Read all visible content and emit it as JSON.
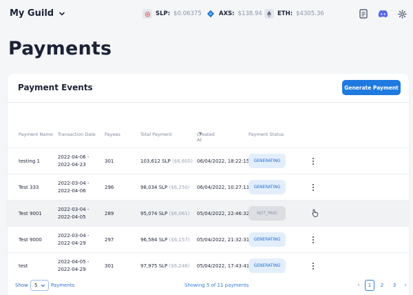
{
  "header": {
    "guild_name": "My Guild",
    "tickers": [
      {
        "symbol": "SLP:",
        "price": "$0.06375",
        "icon": "slp-token-icon"
      },
      {
        "symbol": "AXS:",
        "price": "$138.94",
        "icon": "axs-token-icon"
      },
      {
        "symbol": "ETH:",
        "price": "$4305.36",
        "icon": "eth-token-icon"
      }
    ],
    "icons": [
      "document-icon",
      "discord-icon",
      "gear-icon"
    ]
  },
  "page": {
    "title": "Payments"
  },
  "card": {
    "title": "Payment Events",
    "generate_button": "Generate Payment"
  },
  "table": {
    "columns": [
      "Payment Name",
      "Transaction Date",
      "Payees",
      "Total Payment",
      "Created At",
      "Payment Status"
    ],
    "sort_column": "Created At",
    "rows": [
      {
        "name": "testing 1",
        "date_from": "2022-04-06 -",
        "date_to": "2022-04-23",
        "payees": "301",
        "slp": "103,612 SLP",
        "usd": "($6,605)",
        "created": "06/04/2022, 18:22:15",
        "status": "GENERATING"
      },
      {
        "name": "Test 333",
        "date_from": "2022-03-04 -",
        "date_to": "2022-04-06",
        "payees": "296",
        "slp": "98,034 SLP",
        "usd": "($6,250)",
        "created": "06/04/2022, 10:27:11",
        "status": "GENERATING"
      },
      {
        "name": "Test 9001",
        "date_from": "2022-03-04 -",
        "date_to": "2022-04-05",
        "payees": "289",
        "slp": "95,074 SLP",
        "usd": "($6,061)",
        "created": "05/04/2022, 22:46:32",
        "status": "NOT_PAID"
      },
      {
        "name": "Test 9000",
        "date_from": "2022-03-04 -",
        "date_to": "2022-04-29",
        "payees": "297",
        "slp": "96,584 SLP",
        "usd": "($6,157)",
        "created": "05/04/2022, 21:32:31",
        "status": "GENERATING"
      },
      {
        "name": "test",
        "date_from": "2022-04-05 -",
        "date_to": "2022-04-29",
        "payees": "301",
        "slp": "97,975 SLP",
        "usd": "($6,246)",
        "created": "05/04/2022, 17:43:41",
        "status": "GENERATING"
      }
    ]
  },
  "footer": {
    "show_label": "Show",
    "page_size": "5",
    "payments_label": "Payments",
    "showing_text": "Showing 5 of 11 payments",
    "pages": [
      "1",
      "2",
      "3"
    ],
    "current_page": "1",
    "prev": "‹",
    "next": "›"
  },
  "colors": {
    "accent": "#1f7ae0",
    "generating_bg": "#e3eefc",
    "not_paid_bg": "#dcdee3",
    "title": "#1b2236"
  }
}
